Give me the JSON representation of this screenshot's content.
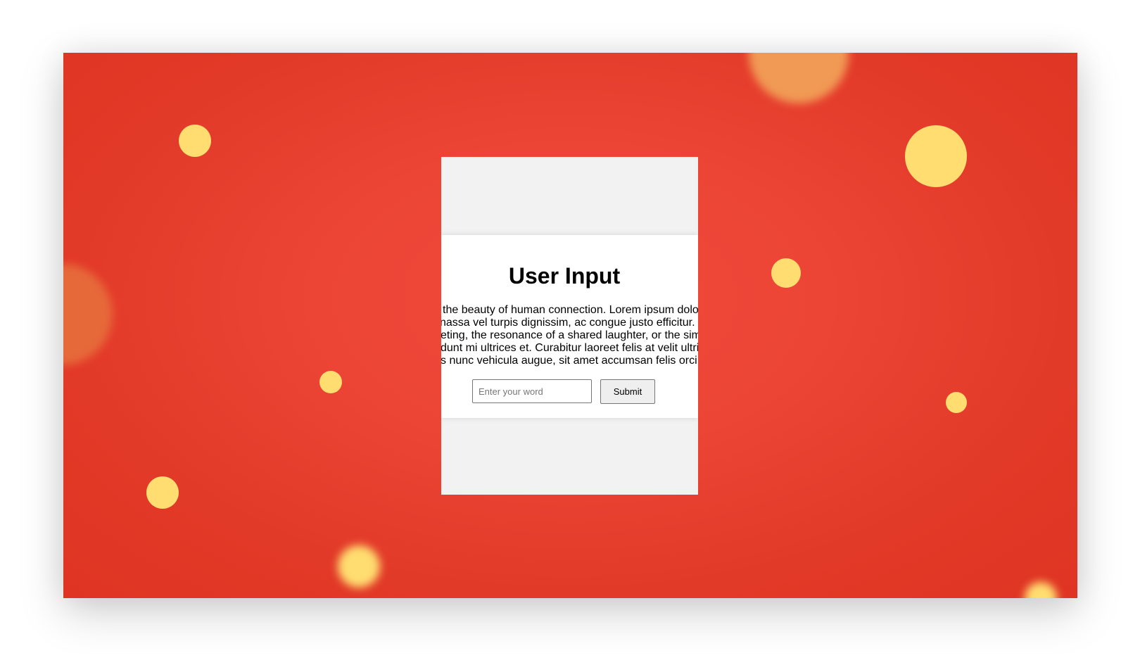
{
  "colors": {
    "background_accent": "#e23a28",
    "dot_yellow": "#ffdd70",
    "dot_orange": "#f09a55",
    "card_bg": "#f2f2f2",
    "panel_bg": "#ffffff"
  },
  "card": {
    "title": "User Input",
    "text_lines": [
      "the beauty of human connection. Lorem ipsum dolo",
      "nassa vel turpis dignissim, ac congue justo efficitur.",
      "eting, the resonance of a shared laughter, or the sim",
      "dunt mi ultrices et. Curabitur laoreet felis at velit ultric",
      "s nunc vehicula augue, sit amet accumsan felis orci"
    ],
    "input": {
      "value": "",
      "placeholder": "Enter your word"
    },
    "submit_label": "Submit"
  }
}
